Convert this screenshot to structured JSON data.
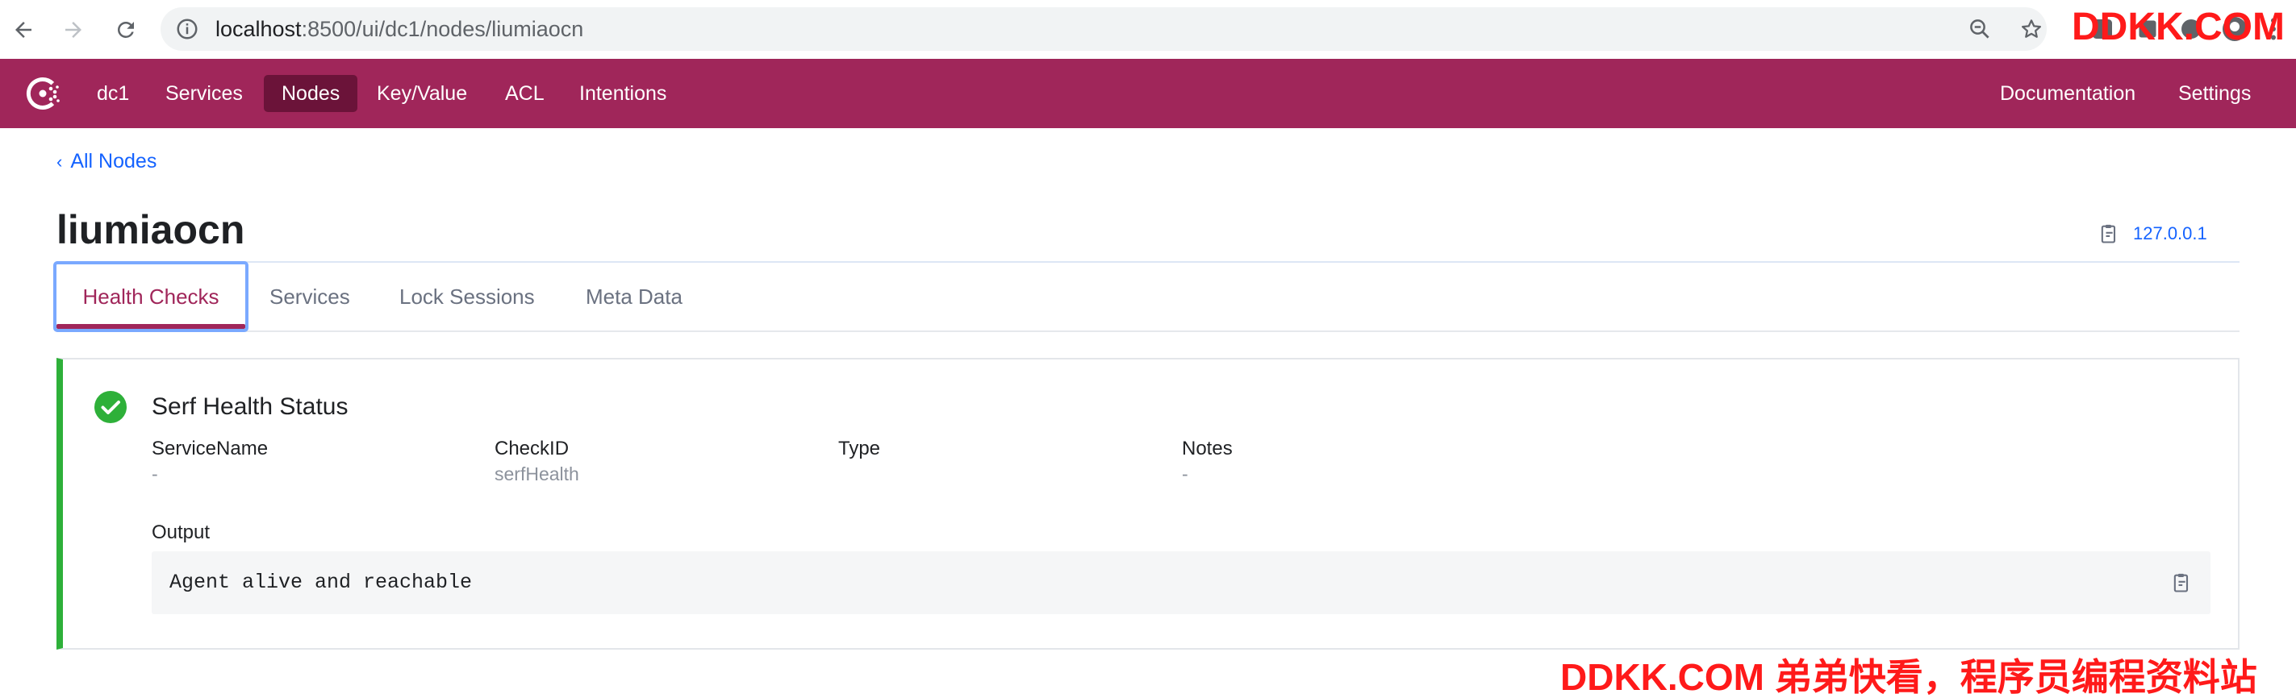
{
  "browser": {
    "url_host": "localhost",
    "url_path": ":8500/ui/dc1/nodes/liumiaocn"
  },
  "nav": {
    "datacenter": "dc1",
    "items": [
      {
        "label": "Services"
      },
      {
        "label": "Nodes"
      },
      {
        "label": "Key/Value"
      },
      {
        "label": "ACL"
      },
      {
        "label": "Intentions"
      }
    ],
    "active": "Nodes",
    "right_items": [
      {
        "label": "Documentation"
      },
      {
        "label": "Settings"
      }
    ]
  },
  "breadcrumb": {
    "label": "All Nodes"
  },
  "node": {
    "name": "liumiaocn",
    "address": "127.0.0.1"
  },
  "tabs": [
    {
      "label": "Health Checks"
    },
    {
      "label": "Services"
    },
    {
      "label": "Lock Sessions"
    },
    {
      "label": "Meta Data"
    }
  ],
  "active_tab": "Health Checks",
  "health_check": {
    "status_color": "#2eb039",
    "title": "Serf Health Status",
    "fields": [
      {
        "label": "ServiceName",
        "value": "-"
      },
      {
        "label": "CheckID",
        "value": "serfHealth"
      },
      {
        "label": "Type",
        "value": ""
      },
      {
        "label": "Notes",
        "value": "-"
      }
    ],
    "output_label": "Output",
    "output": "Agent alive and reachable"
  },
  "colors": {
    "brand": "#a0265a",
    "brand_dark": "#6b1339",
    "link": "#1563ff",
    "passing": "#2eb039"
  },
  "watermark": {
    "top": "DDKK.COM",
    "bottom": "DDKK.COM 弟弟快看，程序员编程资料站"
  }
}
